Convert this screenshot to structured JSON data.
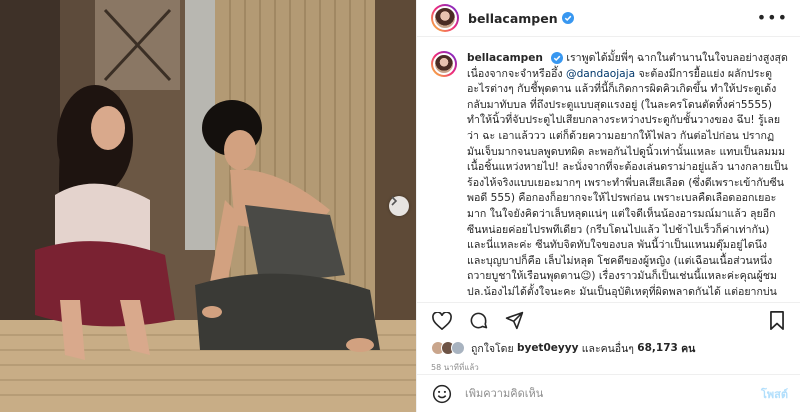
{
  "header": {
    "username": "bellacampen",
    "more_label": "•••"
  },
  "caption": {
    "username": "bellacampen",
    "text_before_mention": "เราพูดได้มั้ยพี่ๆ ฉากในตำนานในใจบลอย่างสูงสุด เนื่องจากจะจำหรืออึ้ง",
    "mention": "@dandaojaja",
    "text_after_mention": "จะต้องมีการยื้อแย่ง ผลักประตูอะไรต่างๆ กับชี้พุดตาน แล้วที่นี้ก็เกิดการผิดคิวเกิดขึ้น ทำให้ประตูเด้งกลับมาทับบล ที่ถึงประตูแบบสุดแรงอยู่ (ในละครโดนตัดทิ้งค่า5555) ทำให้นิ้วที่จับประตูไปเสียบกลางระหว่างประตูกับชั้นวางของ ฉึบ! รู้เลยว่า ฉะ เอาแล้ววว แต่ก็ด้วยความอยากให้ไฟลว กันต่อไปก่อน ปรากฏมันเจ็บมากจนบลพูดบทผิด ละพอกันไปดูนิ้วเท่านั้นแหละ แทบเป็นลมมม เนื้อชิ้นแหว่งหายไป! ละนั่งจากที่จะต้องเล่นดราม่าอยู่แล้ว นางกลายเป็นร้องไห้จริงแบบเยอะมากๆ เพราะทำพี่บลเสียเลือด (ซึ่งดีเพราะเข้ากับซีนพอดี 555) คือกองก็อยากจะให้ไปรพก่อน เพราะเบลคืดเลือดออกเยอะมาก ในใจยังคิดว่าเล็บหลุดแน่ๆ แต่ใจดีเห็นน้องอารมณ์มาแล้ว ลุยอีกซีนหน่อยค่อยไปรพทีเดียว (กรีบโดนไปแล้ว ไปช้าไปเร็วก็ค่าเท่ากัน) และนี่แหละค่ะ ซีนทับจิตทับใจของบล พันนี้ว่าเป็นแหนมดุ๊มอยู่ไดนึง และบุญบาปก็คือ เล็บไม่หลุด โชคดีของผู้หญิง (แต่เฉือนเนื้อส่วนหนึ่งถวายบูชาให้เรือนพุดตาน😉) เรื่องราวมันก็เป็นเช่นนี้แหละค่ะคุณผู้ชม ปล.น้องไม่ได้ตั้งใจนะคะ มันเป็นอุบัติเหตุที่ผิดพลาดกันได้ แต่อยากบ่นมาเล่า"
  },
  "likes": {
    "prefix": "ถูกใจโดย",
    "first_user": "byet0eyyy",
    "middle": "และคนอื่นๆ",
    "count": "68,173",
    "suffix": "คน"
  },
  "timestamp": "58 นาทีที่แล้ว",
  "comment": {
    "placeholder": "เพิ่มความคิดเห็น",
    "post_label": "โพสต์"
  },
  "colors": {
    "verified": "#3897f0",
    "post_button_disabled": "#b2dffc",
    "mention": "#00376b",
    "muted": "#8e8e8e"
  },
  "icons": [
    "heart-icon",
    "comment-icon",
    "share-icon",
    "bookmark-icon",
    "emoji-icon",
    "chevron-right-icon",
    "verified-icon",
    "more-icon"
  ]
}
